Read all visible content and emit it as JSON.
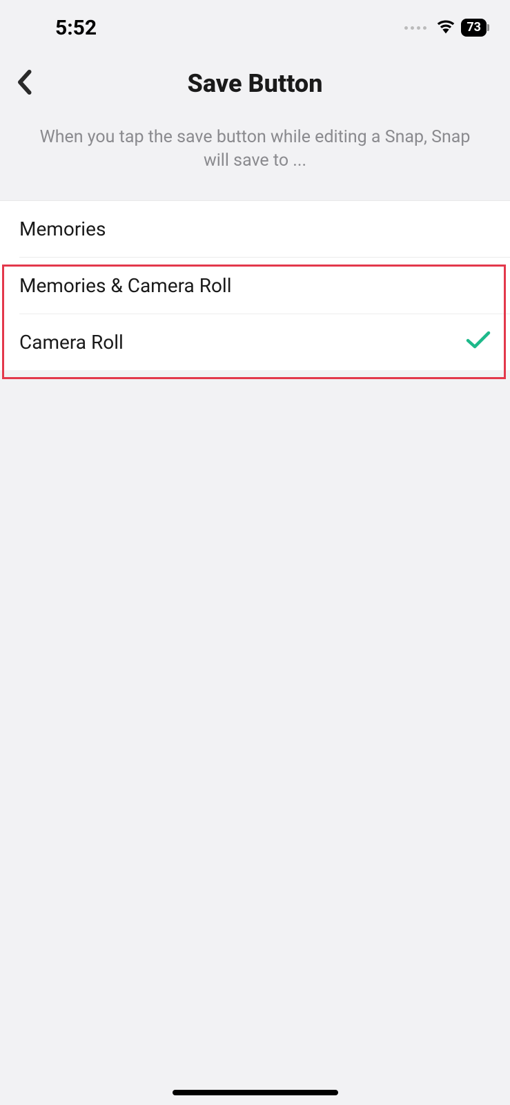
{
  "status": {
    "time": "5:52",
    "battery": "73"
  },
  "header": {
    "title": "Save Button"
  },
  "description": "When you tap the save button while editing a Snap, Snap will save to ...",
  "options": [
    {
      "label": "Memories",
      "selected": false
    },
    {
      "label": "Memories & Camera Roll",
      "selected": false
    },
    {
      "label": "Camera Roll",
      "selected": true
    }
  ]
}
